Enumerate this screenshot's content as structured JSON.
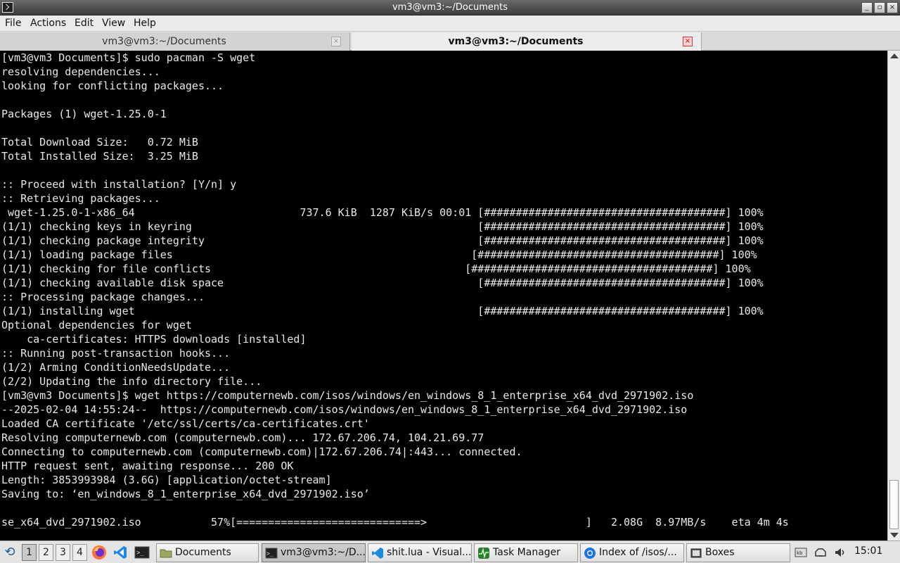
{
  "window": {
    "title": "vm3@vm3:~/Documents",
    "minimize_glyph": "_",
    "maximize_glyph": "▫",
    "close_glyph": "×"
  },
  "menu": [
    "File",
    "Actions",
    "Edit",
    "View",
    "Help"
  ],
  "tabs": [
    {
      "label": "vm3@vm3:~/Documents",
      "active": false,
      "close_glyph": "×"
    },
    {
      "label": "vm3@vm3:~/Documents",
      "active": true,
      "close_glyph": "×"
    }
  ],
  "terminal": {
    "lines": [
      "[vm3@vm3 Documents]$ sudo pacman -S wget",
      "resolving dependencies...",
      "looking for conflicting packages...",
      "",
      "Packages (1) wget-1.25.0-1",
      "",
      "Total Download Size:   0.72 MiB",
      "Total Installed Size:  3.25 MiB",
      "",
      ":: Proceed with installation? [Y/n] y",
      ":: Retrieving packages...",
      " wget-1.25.0-1-x86_64                          737.6 KiB  1287 KiB/s 00:01 [######################################] 100%",
      "(1/1) checking keys in keyring                                             [######################################] 100%",
      "(1/1) checking package integrity                                           [######################################] 100%",
      "(1/1) loading package files                                               [######################################] 100%",
      "(1/1) checking for file conflicts                                        [######################################] 100%",
      "(1/1) checking available disk space                                        [######################################] 100%",
      ":: Processing package changes...",
      "(1/1) installing wget                                                      [######################################] 100%",
      "Optional dependencies for wget",
      "    ca-certificates: HTTPS downloads [installed]",
      ":: Running post-transaction hooks...",
      "(1/2) Arming ConditionNeedsUpdate...",
      "(2/2) Updating the info directory file...",
      "[vm3@vm3 Documents]$ wget https://computernewb.com/isos/windows/en_windows_8_1_enterprise_x64_dvd_2971902.iso",
      "--2025-02-04 14:55:24--  https://computernewb.com/isos/windows/en_windows_8_1_enterprise_x64_dvd_2971902.iso",
      "Loaded CA certificate '/etc/ssl/certs/ca-certificates.crt'",
      "Resolving computernewb.com (computernewb.com)... 172.67.206.74, 104.21.69.77",
      "Connecting to computernewb.com (computernewb.com)|172.67.206.74|:443... connected.",
      "HTTP request sent, awaiting response... 200 OK",
      "Length: 3853993984 (3.6G) [application/octet-stream]",
      "Saving to: ‘en_windows_8_1_enterprise_x64_dvd_2971902.iso’",
      "",
      "se_x64_dvd_2971902.iso           57%[=============================>                         ]   2.08G  8.97MB/s    eta 4m 4s  "
    ],
    "download_progress": 0.57
  },
  "taskbar": {
    "menu_icon": "menu-icon",
    "workspaces": [
      "1",
      "2",
      "3",
      "4"
    ],
    "active_workspace": 0,
    "launchers": [
      "firefox-icon",
      "vscode-icon",
      "terminal-icon"
    ],
    "tasks": [
      {
        "label": "Documents",
        "icon": "folder-icon",
        "active": false
      },
      {
        "label": "vm3@vm3:~/D...",
        "icon": "terminal-icon",
        "active": true
      },
      {
        "label": "shit.lua - Visual...",
        "icon": "vscode-icon",
        "active": false
      },
      {
        "label": "Task Manager",
        "icon": "task-manager-icon",
        "active": false
      },
      {
        "label": "Index of /isos/...",
        "icon": "chromium-icon",
        "active": false
      },
      {
        "label": "Boxes",
        "icon": "boxes-icon",
        "active": false
      }
    ],
    "tray": [
      "keyboard-icon",
      "network-icon",
      "volume-icon"
    ],
    "clock": "15:01",
    "colors": {
      "vscode": "#1e88e5",
      "firefox": "#ff7139",
      "taskmgr": "#2e7d32",
      "chromium": "#1a73e8"
    }
  }
}
